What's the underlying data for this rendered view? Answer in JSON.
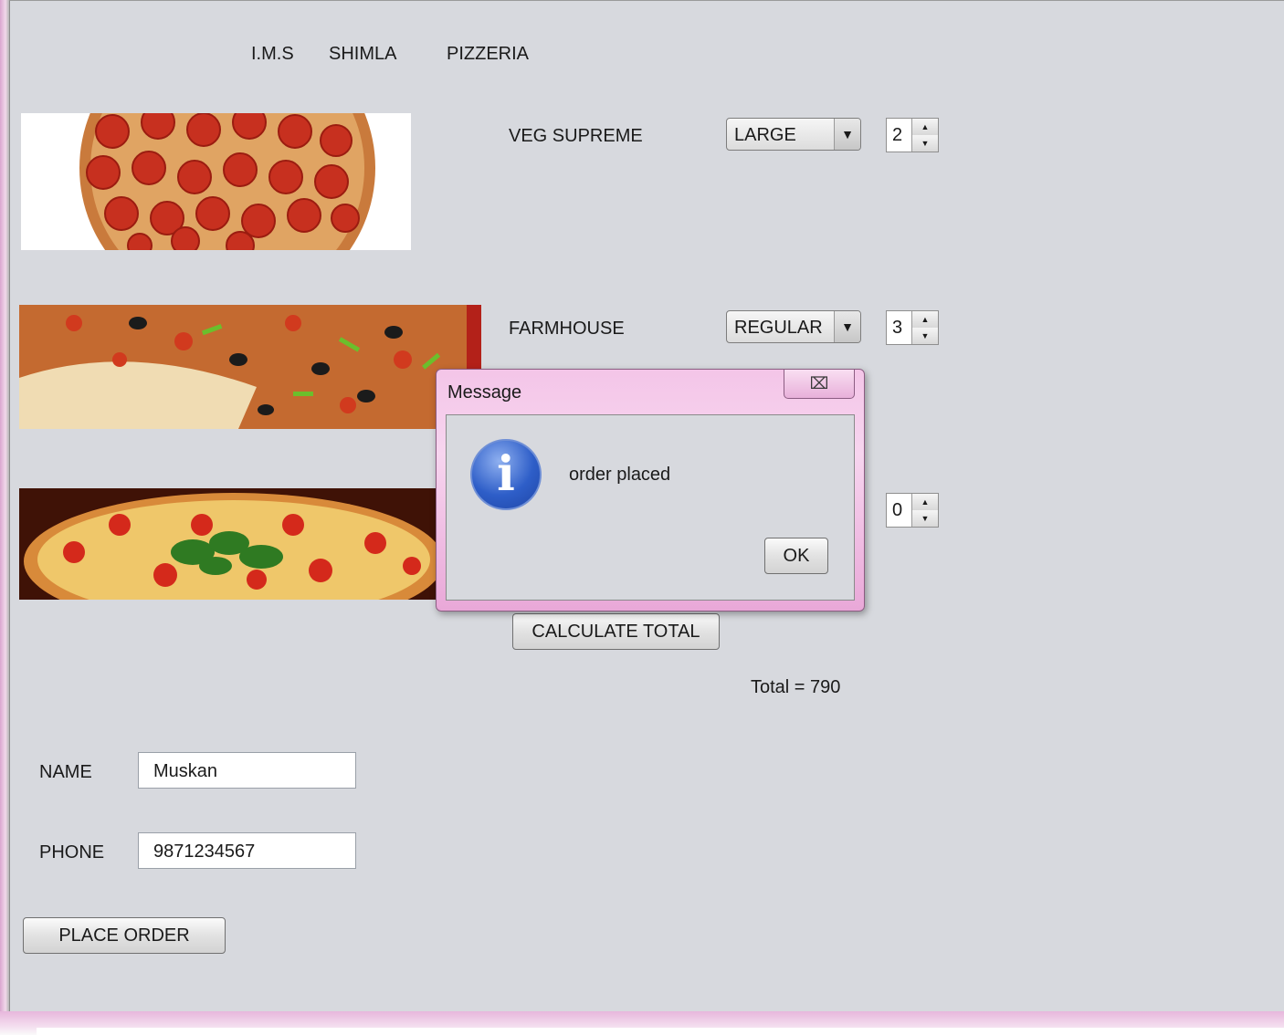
{
  "header": {
    "word1": "I.M.S",
    "word2": "SHIMLA",
    "word3": "PIZZERIA"
  },
  "items": [
    {
      "name": "VEG SUPREME",
      "size": "LARGE",
      "qty": "2"
    },
    {
      "name": "FARMHOUSE",
      "size": "REGULAR",
      "qty": "3"
    },
    {
      "name": "",
      "size": "",
      "qty": "0"
    }
  ],
  "calculate_label": "CALCULATE TOTAL",
  "total_text": "Total = 790",
  "form": {
    "name_label": "NAME",
    "name_value": "Muskan",
    "phone_label": "PHONE",
    "phone_value": "9871234567",
    "place_order_label": "PLACE ORDER"
  },
  "dialog": {
    "title": "Message",
    "message": "order placed",
    "ok_label": "OK",
    "close_glyph": "⌧",
    "icon_glyph": "i"
  },
  "icons": {
    "combo_arrow": "▼",
    "spin_up": "▲",
    "spin_down": "▼"
  },
  "colors": {
    "panel": "#d7d9de",
    "dialog_frame": "#f4c5e8",
    "info_icon": "#2e5ec8"
  }
}
